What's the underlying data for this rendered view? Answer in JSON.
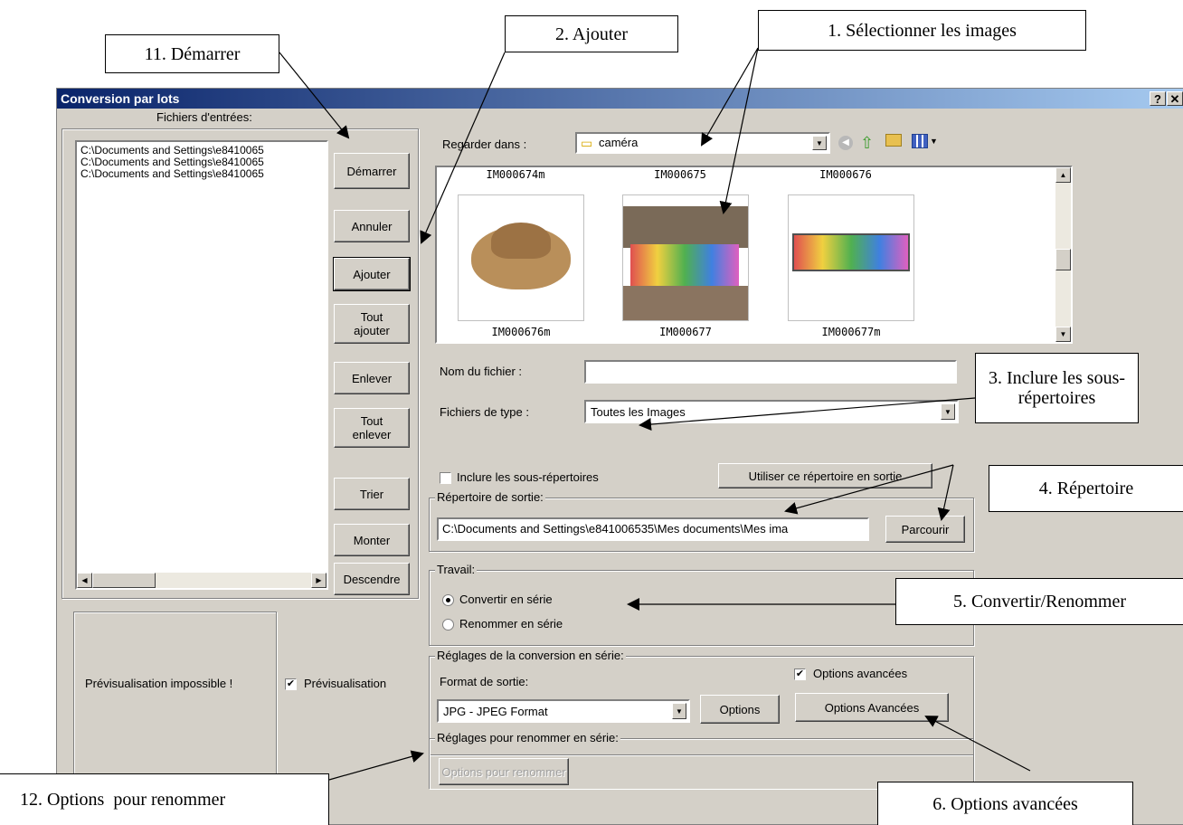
{
  "window": {
    "title": "Conversion par lots",
    "help": "?",
    "close": "✕"
  },
  "left": {
    "input_files_label": "Fichiers d'entrées:",
    "files": [
      "C:\\Documents and Settings\\e8410065",
      "C:\\Documents and Settings\\e8410065",
      "C:\\Documents and Settings\\e8410065"
    ],
    "buttons": {
      "start": "Démarrer",
      "cancel": "Annuler",
      "add": "Ajouter",
      "add_all": "Tout ajouter",
      "remove": "Enlever",
      "remove_all": "Tout enlever",
      "sort": "Trier",
      "up": "Monter",
      "down": "Descendre"
    },
    "preview_text": "Prévisualisation impossible !",
    "preview_check": "Prévisualisation"
  },
  "browser": {
    "look_in_label": "Regarder dans :",
    "look_in_value": "caméra",
    "top_captions": [
      "IM000674m",
      "IM000675",
      "IM000676"
    ],
    "bottom_captions": [
      "IM000676m",
      "IM000677",
      "IM000677m"
    ],
    "filename_label": "Nom du fichier :",
    "filename_value": "",
    "filetype_label": "Fichiers de type :",
    "filetype_value": "Toutes les Images",
    "include_sub": "Inclure les sous-répertoires",
    "use_dir": "Utiliser ce répertoire en sortie"
  },
  "output": {
    "group": "Répertoire de sortie:",
    "path": "C:\\Documents and Settings\\e841006535\\Mes documents\\Mes ima",
    "browse": "Parcourir"
  },
  "work": {
    "group": "Travail:",
    "convert": "Convertir en série",
    "rename": "Renommer en série"
  },
  "conversion": {
    "group": "Réglages de la conversion en série:",
    "format_label": "Format de sortie:",
    "format_value": "JPG - JPEG Format",
    "options": "Options",
    "advanced_check": "Options avancées",
    "advanced_btn": "Options Avancées"
  },
  "rename": {
    "group": "Réglages pour renommer en série:",
    "options": "Options pour renommer"
  },
  "callouts": {
    "c1": "1. Sélectionner les images",
    "c2": "2. Ajouter",
    "c3": "3. Inclure les sous-répertoires",
    "c4": "4. Répertoire",
    "c5": "5. Convertir/Renommer",
    "c6": "6. Options avancées",
    "c11": "11. Démarrer",
    "c12": "12. Options  pour renommer"
  }
}
